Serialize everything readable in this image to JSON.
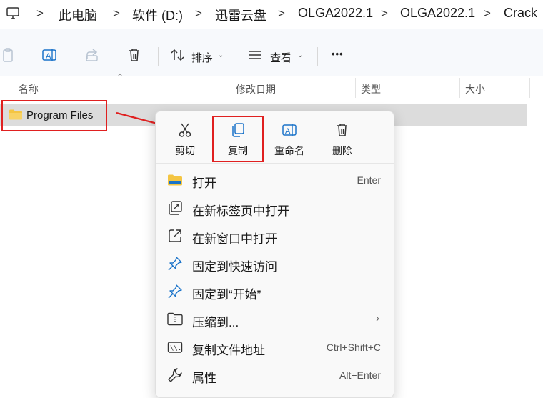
{
  "breadcrumb": {
    "items": [
      "此电脑",
      "软件 (D:)",
      "迅雷云盘",
      "OLGA2022.1",
      "OLGA2022.1",
      "Crack"
    ],
    "separator": ">"
  },
  "toolbar": {
    "sort_label": "排序",
    "view_label": "查看",
    "more_label": "•••"
  },
  "columns": {
    "name": "名称",
    "modified": "修改日期",
    "type": "类型",
    "size": "大小"
  },
  "files": [
    {
      "name": "Program Files"
    }
  ],
  "context_menu": {
    "quick_actions": [
      {
        "label": "剪切",
        "icon": "scissors-icon"
      },
      {
        "label": "复制",
        "icon": "copy-icon"
      },
      {
        "label": "重命名",
        "icon": "rename-icon"
      },
      {
        "label": "删除",
        "icon": "trash-icon"
      }
    ],
    "items": [
      {
        "label": "打开",
        "shortcut": "Enter",
        "icon": "folder-icon"
      },
      {
        "label": "在新标签页中打开",
        "shortcut": "",
        "icon": "new-tab-icon"
      },
      {
        "label": "在新窗口中打开",
        "shortcut": "",
        "icon": "new-window-icon"
      },
      {
        "label": "固定到快速访问",
        "shortcut": "",
        "icon": "pin-icon"
      },
      {
        "label": "固定到“开始”",
        "shortcut": "",
        "icon": "pin-icon"
      },
      {
        "label": "压缩到...",
        "shortcut": "",
        "icon": "zip-icon"
      },
      {
        "label": "复制文件地址",
        "shortcut": "Ctrl+Shift+C",
        "icon": "path-icon"
      },
      {
        "label": "属性",
        "shortcut": "Alt+Enter",
        "icon": "wrench-icon"
      }
    ]
  },
  "colors": {
    "accent": "#1a73c9",
    "highlight_red": "#e02020",
    "folder_yellow": "#f4c542"
  }
}
